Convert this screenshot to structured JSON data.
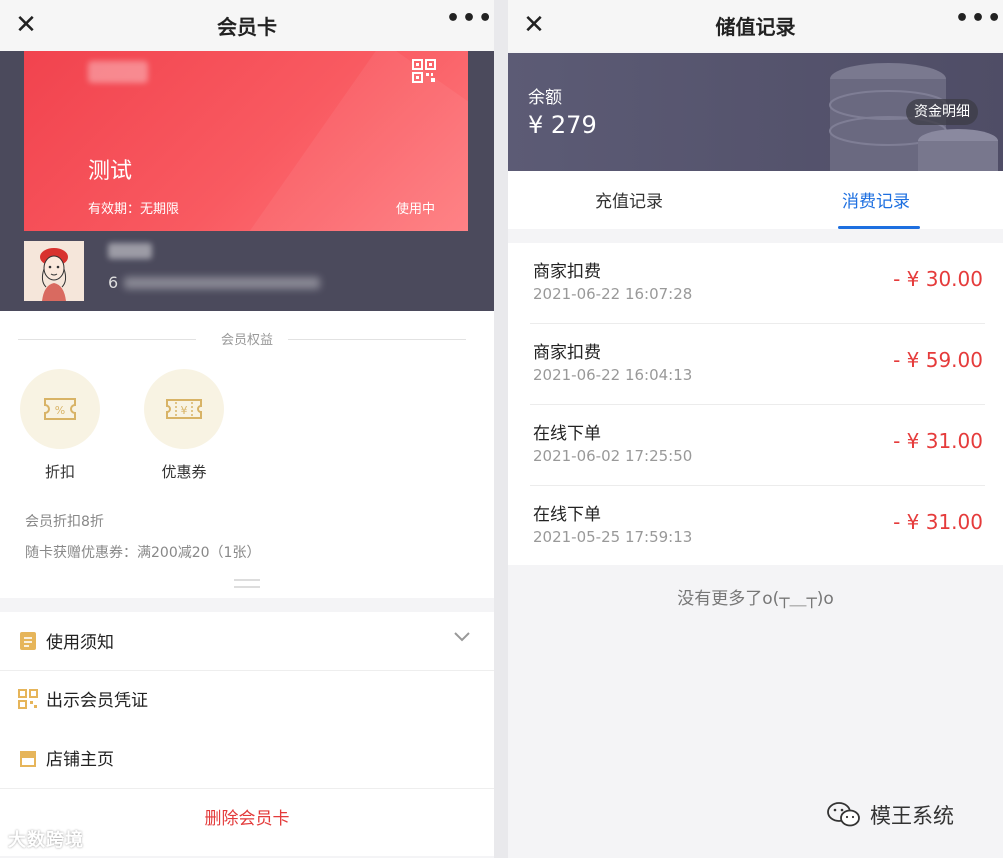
{
  "left": {
    "nav": {
      "close": "✕",
      "title": "会员卡",
      "more": "•••"
    },
    "card": {
      "name": "测试",
      "validity": "有效期：无期限",
      "status": "使用中",
      "number_prefix": "6"
    },
    "benefits": {
      "title": "会员权益",
      "items": [
        {
          "label": "折扣",
          "icon": "discount-ticket-icon"
        },
        {
          "label": "优惠券",
          "icon": "coupon-ticket-icon"
        }
      ],
      "desc": [
        "会员折扣8折",
        "随卡获赠优惠券：满200减20（1张）"
      ]
    },
    "menu": {
      "items": [
        {
          "label": "使用须知",
          "icon": "notice-doc-icon"
        },
        {
          "label": "出示会员凭证",
          "icon": "qr-code-icon"
        },
        {
          "label": "店铺主页",
          "icon": "shop-icon"
        }
      ],
      "delete": "删除会员卡"
    },
    "watermark": "大数跨境"
  },
  "right": {
    "nav": {
      "close": "✕",
      "title": "储值记录",
      "more": "•••"
    },
    "balance": {
      "label": "余额",
      "amount": "¥ 279",
      "fund_detail": "资金明细"
    },
    "tabs": [
      "充值记录",
      "消费记录"
    ],
    "active_tab": "消费记录",
    "records": [
      {
        "title": "商家扣费",
        "time": "2021-06-22 16:07:28",
        "amount": "- ¥ 30.00"
      },
      {
        "title": "商家扣费",
        "time": "2021-06-22 16:04:13",
        "amount": "- ¥ 59.00"
      },
      {
        "title": "在线下单",
        "time": "2021-06-02 17:25:50",
        "amount": "- ¥ 31.00"
      },
      {
        "title": "在线下单",
        "time": "2021-05-25 17:59:13",
        "amount": "- ¥ 31.00"
      }
    ],
    "no_more": "没有更多了o(┬＿┬)o",
    "watermark": "模王系统"
  },
  "colors": {
    "card_red": "#f1434e",
    "accent_blue": "#1d6fe0",
    "amount_red": "#e53b3b",
    "header_slate": "#4b4a5c"
  }
}
